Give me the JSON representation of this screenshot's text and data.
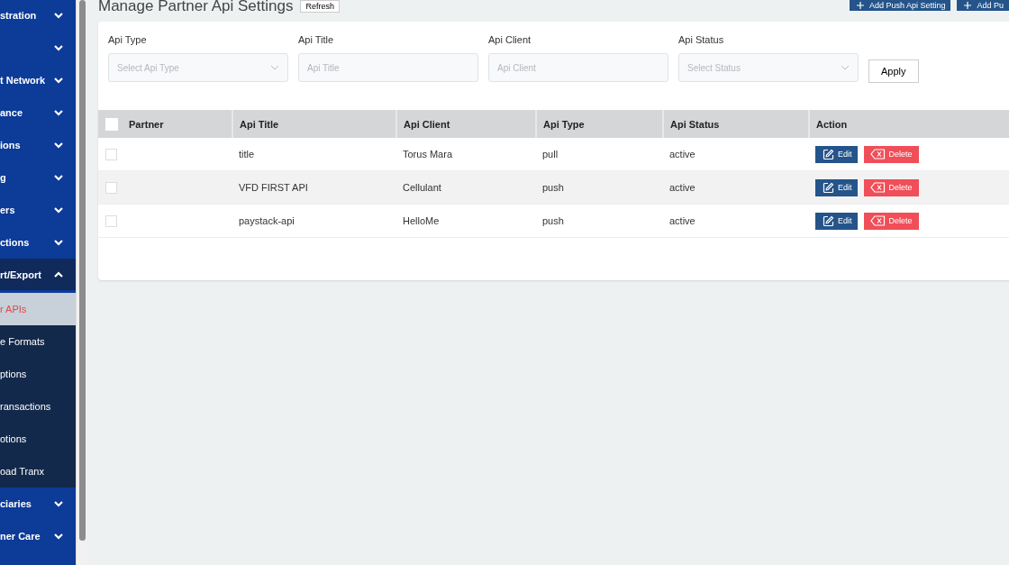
{
  "sidebar": {
    "items": [
      {
        "label": "stration",
        "expanded": false
      },
      {
        "expanded": false
      },
      {
        "label": "t Network",
        "expanded": false
      },
      {
        "label": "ance",
        "expanded": false
      },
      {
        "label": "ions",
        "expanded": false
      },
      {
        "label": "g",
        "expanded": false
      },
      {
        "label": "ers",
        "expanded": false
      },
      {
        "label": "ctions",
        "expanded": false
      },
      {
        "label": "rt/Export",
        "expanded": true,
        "children": [
          {
            "label": "r APIs",
            "selected": true
          },
          {
            "label": "e Formats",
            "selected": false
          },
          {
            "label": "ptions",
            "selected": false
          },
          {
            "label": "ransactions",
            "selected": false
          },
          {
            "label": "otions",
            "selected": false
          },
          {
            "label": "oad Tranx",
            "selected": false
          }
        ]
      },
      {
        "label": "ciaries",
        "expanded": false
      },
      {
        "label": "ner Care",
        "expanded": false
      }
    ]
  },
  "page": {
    "title": "Manage Partner Api Settings",
    "refresh": "Refresh",
    "actions": [
      "Add Push Api Setting",
      "Add Pu"
    ]
  },
  "filters": [
    {
      "label": "Api Type",
      "kind": "select",
      "placeholder": "Select Api Type"
    },
    {
      "label": "Api Title",
      "kind": "text",
      "placeholder": "Api Title"
    },
    {
      "label": "Api Client",
      "kind": "text",
      "placeholder": "Api Client"
    },
    {
      "label": "Api Status",
      "kind": "select",
      "placeholder": "Select Status"
    }
  ],
  "apply": "Apply",
  "table": {
    "select_all_checked": false,
    "columns": [
      "Partner",
      "Api Title",
      "Api Client",
      "Api Type",
      "Api Status",
      "Action"
    ],
    "rows": [
      {
        "checked": false,
        "cells": [
          "",
          "title",
          "Torus Mara",
          "pull",
          "active"
        ],
        "edit": "Edit",
        "delete": "Delete"
      },
      {
        "checked": false,
        "cells": [
          "",
          "VFD FIRST API",
          "Cellulant",
          "push",
          "active"
        ],
        "edit": "Edit",
        "delete": "Delete"
      },
      {
        "checked": false,
        "cells": [
          "",
          "paystack-api",
          "HelloMe",
          "push",
          "active"
        ],
        "edit": "Edit",
        "delete": "Delete"
      }
    ]
  }
}
